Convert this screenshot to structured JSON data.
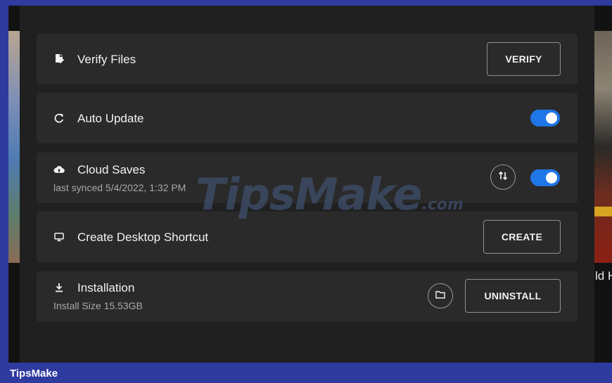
{
  "rows": {
    "verify": {
      "title": "Verify Files",
      "button": "VERIFY"
    },
    "auto_update": {
      "title": "Auto Update",
      "enabled": true
    },
    "cloud_saves": {
      "title": "Cloud Saves",
      "subtitle": "last synced 5/4/2022, 1:32 PM",
      "enabled": true
    },
    "desktop_shortcut": {
      "title": "Create Desktop Shortcut",
      "button": "CREATE"
    },
    "installation": {
      "title": "Installation",
      "subtitle": "Install Size 15.53GB",
      "button": "UNINSTALL"
    }
  },
  "icons": {
    "verify": "file-check-icon",
    "auto_update": "refresh-icon",
    "cloud_saves": "cloud-upload-icon",
    "sync": "sync-arrows-icon",
    "desktop_shortcut": "monitor-icon",
    "installation": "download-icon",
    "folder": "folder-icon"
  },
  "background": {
    "right_text": "ld H"
  },
  "watermark": {
    "main": "TipsMake",
    "suffix": ".com"
  },
  "footer": {
    "brand": "TipsMake"
  },
  "colors": {
    "toggle_on": "#1f76e6",
    "row_bg": "#2a2a2a",
    "panel_bg": "#202020",
    "footer_bg": "#2f3a9f"
  }
}
